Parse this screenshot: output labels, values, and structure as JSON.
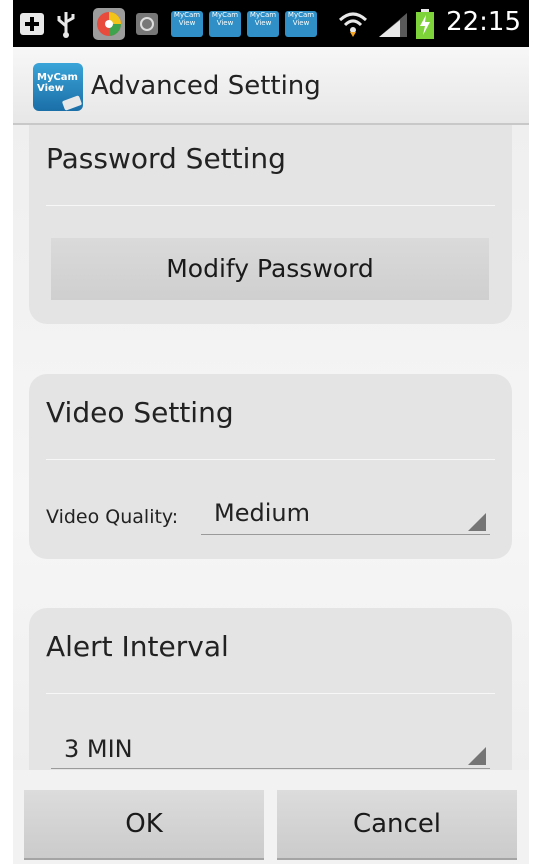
{
  "status_bar": {
    "time": "22:15",
    "notification_icons": [
      "add-icon",
      "usb-icon",
      "color-app-icon",
      "camera-icon",
      "mycam-view-icon",
      "mycam-view-icon",
      "mycam-view-icon",
      "mycam-view-icon"
    ],
    "notification_labels": [
      "MyCam View",
      "MyCam View",
      "MyCam View",
      "MyCam View"
    ],
    "right_icons": [
      "wifi-icon",
      "signal-icon",
      "battery-charging-icon"
    ]
  },
  "header": {
    "logo_text": "MyCam View",
    "title": "Advanced Setting"
  },
  "password_section": {
    "title": "Password Setting",
    "button_label": "Modify Password"
  },
  "video_section": {
    "title": "Video Setting",
    "quality_label": "Video Quality:",
    "quality_value": "Medium"
  },
  "alert_section": {
    "title": "Alert Interval",
    "interval_value": "3 MIN"
  },
  "footer": {
    "ok_label": "OK",
    "cancel_label": "Cancel"
  }
}
